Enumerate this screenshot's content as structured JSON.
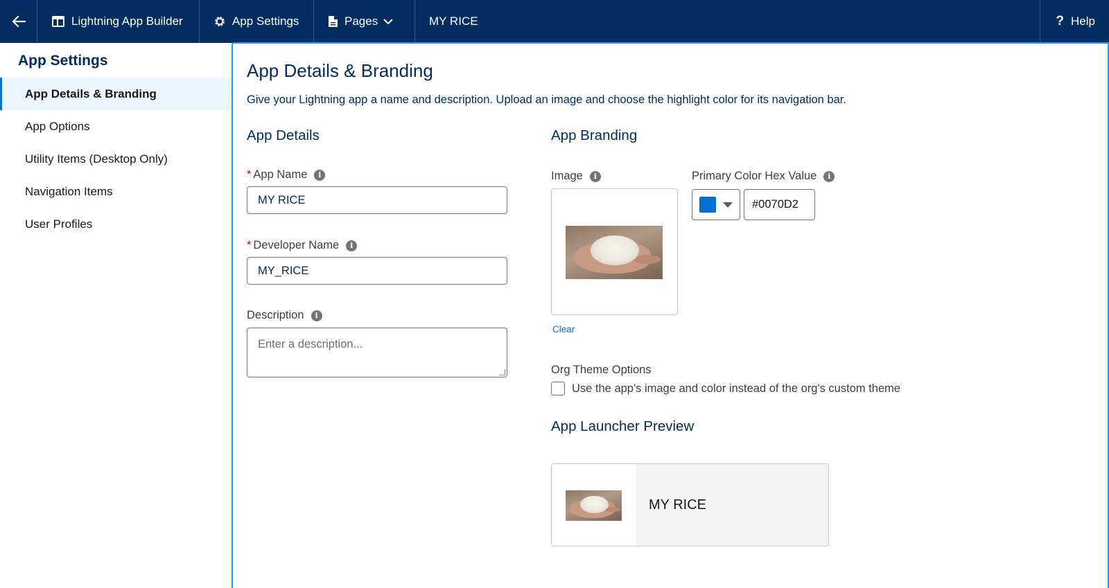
{
  "topbar": {
    "builder_label": "Lightning App Builder",
    "settings_label": "App Settings",
    "pages_label": "Pages",
    "app_label": "MY RICE",
    "help_label": "Help"
  },
  "sidebar": {
    "title": "App Settings",
    "items": [
      {
        "label": "App Details & Branding"
      },
      {
        "label": "App Options"
      },
      {
        "label": "Utility Items (Desktop Only)"
      },
      {
        "label": "Navigation Items"
      },
      {
        "label": "User Profiles"
      }
    ]
  },
  "main": {
    "title": "App Details & Branding",
    "description": "Give your Lightning app a name and description. Upload an image and choose the highlight color for its navigation bar.",
    "details": {
      "title": "App Details",
      "app_name_label": "App Name",
      "app_name_value": "MY RICE",
      "developer_name_label": "Developer Name",
      "developer_name_value": "MY_RICE",
      "description_label": "Description",
      "description_placeholder": "Enter a description..."
    },
    "branding": {
      "title": "App Branding",
      "image_label": "Image",
      "clear_label": "Clear",
      "color_label": "Primary Color Hex Value",
      "color_value": "#0070D2",
      "org_theme_label": "Org Theme Options",
      "org_theme_checkbox_label": "Use the app's image and color instead of the org's custom theme",
      "preview_title": "App Launcher Preview",
      "preview_app_name": "MY RICE"
    }
  },
  "colors": {
    "topbar": "#032d60",
    "accent": "#0176d3",
    "primary_color": "#0070d2",
    "required": "#ba0517"
  }
}
